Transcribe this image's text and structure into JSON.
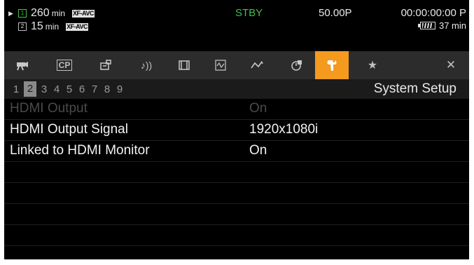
{
  "status": {
    "slot1": {
      "number": "1",
      "remaining": "260",
      "unit": "min",
      "format": "XF-AVC",
      "active": true
    },
    "slot2": {
      "number": "2",
      "remaining": "15",
      "unit": "min",
      "format": "XF-AVC",
      "active": false
    },
    "mode": "STBY",
    "frame_rate": "50.00P",
    "timecode": "00:00:00:00",
    "timecode_suffix": "P",
    "battery_remaining": "37 min"
  },
  "tabs": [
    {
      "name": "tab-camera-setup",
      "icon": "camera-icon",
      "glyph": ""
    },
    {
      "name": "tab-custom-picture",
      "icon": "cp-icon",
      "glyph": "CP"
    },
    {
      "name": "tab-recording-setup",
      "icon": "recording-icon",
      "glyph": ""
    },
    {
      "name": "tab-audio-setup",
      "icon": "audio-icon",
      "glyph": "♪))"
    },
    {
      "name": "tab-lcd-setup",
      "icon": "film-icon",
      "glyph": ""
    },
    {
      "name": "tab-assistance",
      "icon": "assist-icon",
      "glyph": ""
    },
    {
      "name": "tab-network",
      "icon": "network-icon",
      "glyph": ""
    },
    {
      "name": "tab-tc-setup",
      "icon": "clock-icon",
      "glyph": ""
    },
    {
      "name": "tab-system-setup",
      "icon": "wrench-icon",
      "glyph": "",
      "active": true
    },
    {
      "name": "tab-my-menu",
      "icon": "star-icon",
      "glyph": "★"
    },
    {
      "name": "tab-close",
      "icon": "close-icon",
      "glyph": "✕"
    }
  ],
  "pages": [
    "1",
    "2",
    "3",
    "4",
    "5",
    "6",
    "7",
    "8",
    "9"
  ],
  "active_page": "2",
  "menu_title": "System Setup",
  "menu_items": [
    {
      "label": "HDMI Output",
      "value": "On",
      "enabled": false
    },
    {
      "label": "HDMI Output Signal",
      "value": "1920x1080i",
      "enabled": true
    },
    {
      "label": "Linked to HDMI Monitor",
      "value": "On",
      "enabled": true
    },
    {
      "label": "",
      "value": "",
      "enabled": true
    },
    {
      "label": "",
      "value": "",
      "enabled": true
    },
    {
      "label": "",
      "value": "",
      "enabled": true
    },
    {
      "label": "",
      "value": "",
      "enabled": true
    },
    {
      "label": "",
      "value": "",
      "enabled": true
    }
  ],
  "colors": {
    "active_tab": "#f39a1f",
    "standby": "#3ec04a",
    "background": "#000000"
  }
}
